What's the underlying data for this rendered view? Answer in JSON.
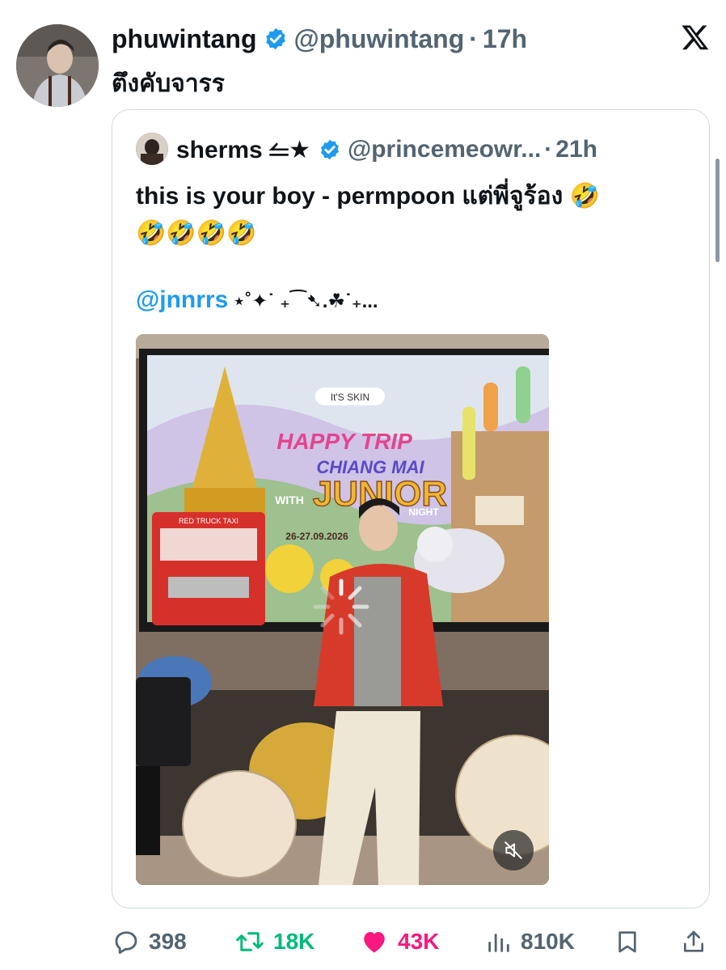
{
  "tweet": {
    "author_name": "phuwintang",
    "author_handle": "@phuwintang",
    "separator": "·",
    "time": "17h",
    "text": "ตึงคับจารร"
  },
  "quoted_tweet": {
    "author_name": "sherms ⥪★",
    "author_handle": "@princemeowr...",
    "separator": "·",
    "time": "21h",
    "text_line1": "this is your boy - permpoon แต่พี่จูร้อง 🤣",
    "text_line2": "🤣🤣🤣🤣",
    "mention": "@jnnrrs",
    "mention_decoration": "⋆˚✦˙ ₊⁀➷.☘︎˙₊..."
  },
  "media": {
    "screen_logo": "It'S SKIN",
    "screen_title_1": "HAPPY TRIP",
    "screen_title_2": "CHIANG MAI",
    "screen_with": "WITH",
    "screen_title_3": "JUNIOR",
    "screen_date": "26-27.09.2026",
    "screen_night": "NIGHT",
    "truck_label": "RED TRUCK TAXI"
  },
  "actions": {
    "replies": "398",
    "retweets": "18K",
    "likes": "43K",
    "views": "810K"
  },
  "colors": {
    "verified_blue": "#1d9bf0",
    "retweet_green": "#00ba7c",
    "like_pink": "#f91880",
    "secondary_gray": "#536471"
  }
}
